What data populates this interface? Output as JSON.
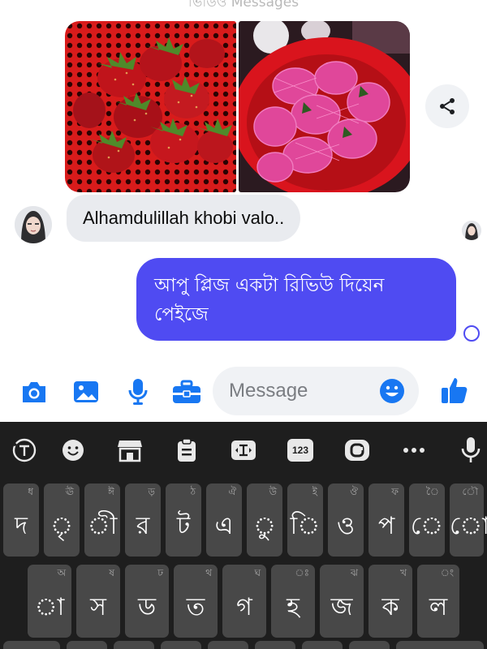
{
  "chat": {
    "top_hint": "ভিডিও Messages",
    "images": [
      {
        "alt": "strawberries in red basket",
        "icon": "photo-strawberries"
      },
      {
        "alt": "pink netted fruits in red basket",
        "icon": "photo-pink-fruits"
      }
    ],
    "share_icon": "share-icon",
    "incoming_message": "Alhamdulillah khobi valo..",
    "outgoing_message_line1": "আপু প্লিজ একটা রিভিউ দিয়েন",
    "outgoing_message_line2": "পেইজে",
    "colors": {
      "outgoing_bubble": "#4f4bf2",
      "incoming_bubble": "#e9ebef",
      "accent": "#1877f2"
    }
  },
  "composer": {
    "icons": [
      "camera-icon",
      "gallery-icon",
      "microphone-icon",
      "toolbox-icon",
      "emoji-icon",
      "thumbs-up-icon"
    ],
    "placeholder": "Message"
  },
  "keyboard": {
    "toolbar": {
      "icons": [
        "translate-icon",
        "emoji-icon",
        "store-icon",
        "clipboard-icon",
        "text-cursor-icon",
        "numbers-icon",
        "gif-icon",
        "more-icon",
        "microphone-icon"
      ],
      "numbers_label": "123"
    },
    "row1": [
      {
        "main": "দ",
        "hint": "ধ"
      },
      {
        "main": "ৃ",
        "hint": "ঊ"
      },
      {
        "main": "ী",
        "hint": "ঈ"
      },
      {
        "main": "র",
        "hint": "ড়"
      },
      {
        "main": "ট",
        "hint": "ঠ"
      },
      {
        "main": "এ",
        "hint": "ঐ"
      },
      {
        "main": "ু",
        "hint": "উ"
      },
      {
        "main": "ি",
        "hint": "ই"
      },
      {
        "main": "ও",
        "hint": "ঔ"
      },
      {
        "main": "প",
        "hint": "ফ"
      },
      {
        "main": "ে",
        "hint": "ৈ"
      },
      {
        "main": "ো",
        "hint": "ৌ"
      }
    ],
    "row2": [
      {
        "main": "া",
        "hint": "অ"
      },
      {
        "main": "স",
        "hint": "ষ"
      },
      {
        "main": "ড",
        "hint": "ঢ"
      },
      {
        "main": "ত",
        "hint": "থ"
      },
      {
        "main": "গ",
        "hint": "ঘ"
      },
      {
        "main": "হ",
        "hint": "ঃ"
      },
      {
        "main": "জ",
        "hint": "ঝ"
      },
      {
        "main": "ক",
        "hint": "খ"
      },
      {
        "main": "ল",
        "hint": "ং"
      }
    ]
  }
}
